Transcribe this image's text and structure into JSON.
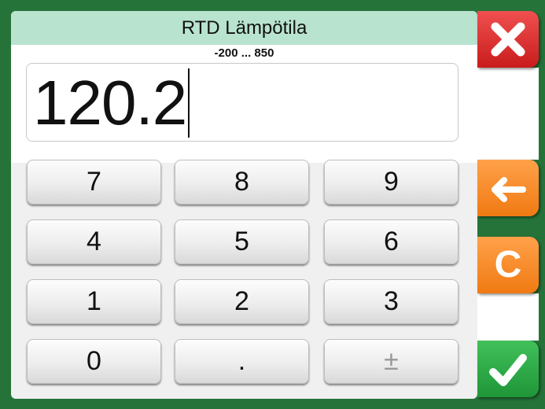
{
  "dialog": {
    "title": "RTD Lämpötila",
    "range": "-200 ... 850",
    "value": "120.2"
  },
  "keypad": {
    "keys": [
      "7",
      "8",
      "9",
      "4",
      "5",
      "6",
      "1",
      "2",
      "3",
      "0",
      ".",
      "±"
    ]
  },
  "side_buttons": {
    "close_icon": "close-icon",
    "backspace_icon": "arrow-left-icon",
    "clear_label": "C",
    "ok_icon": "check-icon"
  },
  "colors": {
    "frame": "#26733a",
    "title_bg": "#b8e3cf",
    "close": "#dd2e2e",
    "orange": "#f4861f",
    "green": "#2aa845"
  }
}
